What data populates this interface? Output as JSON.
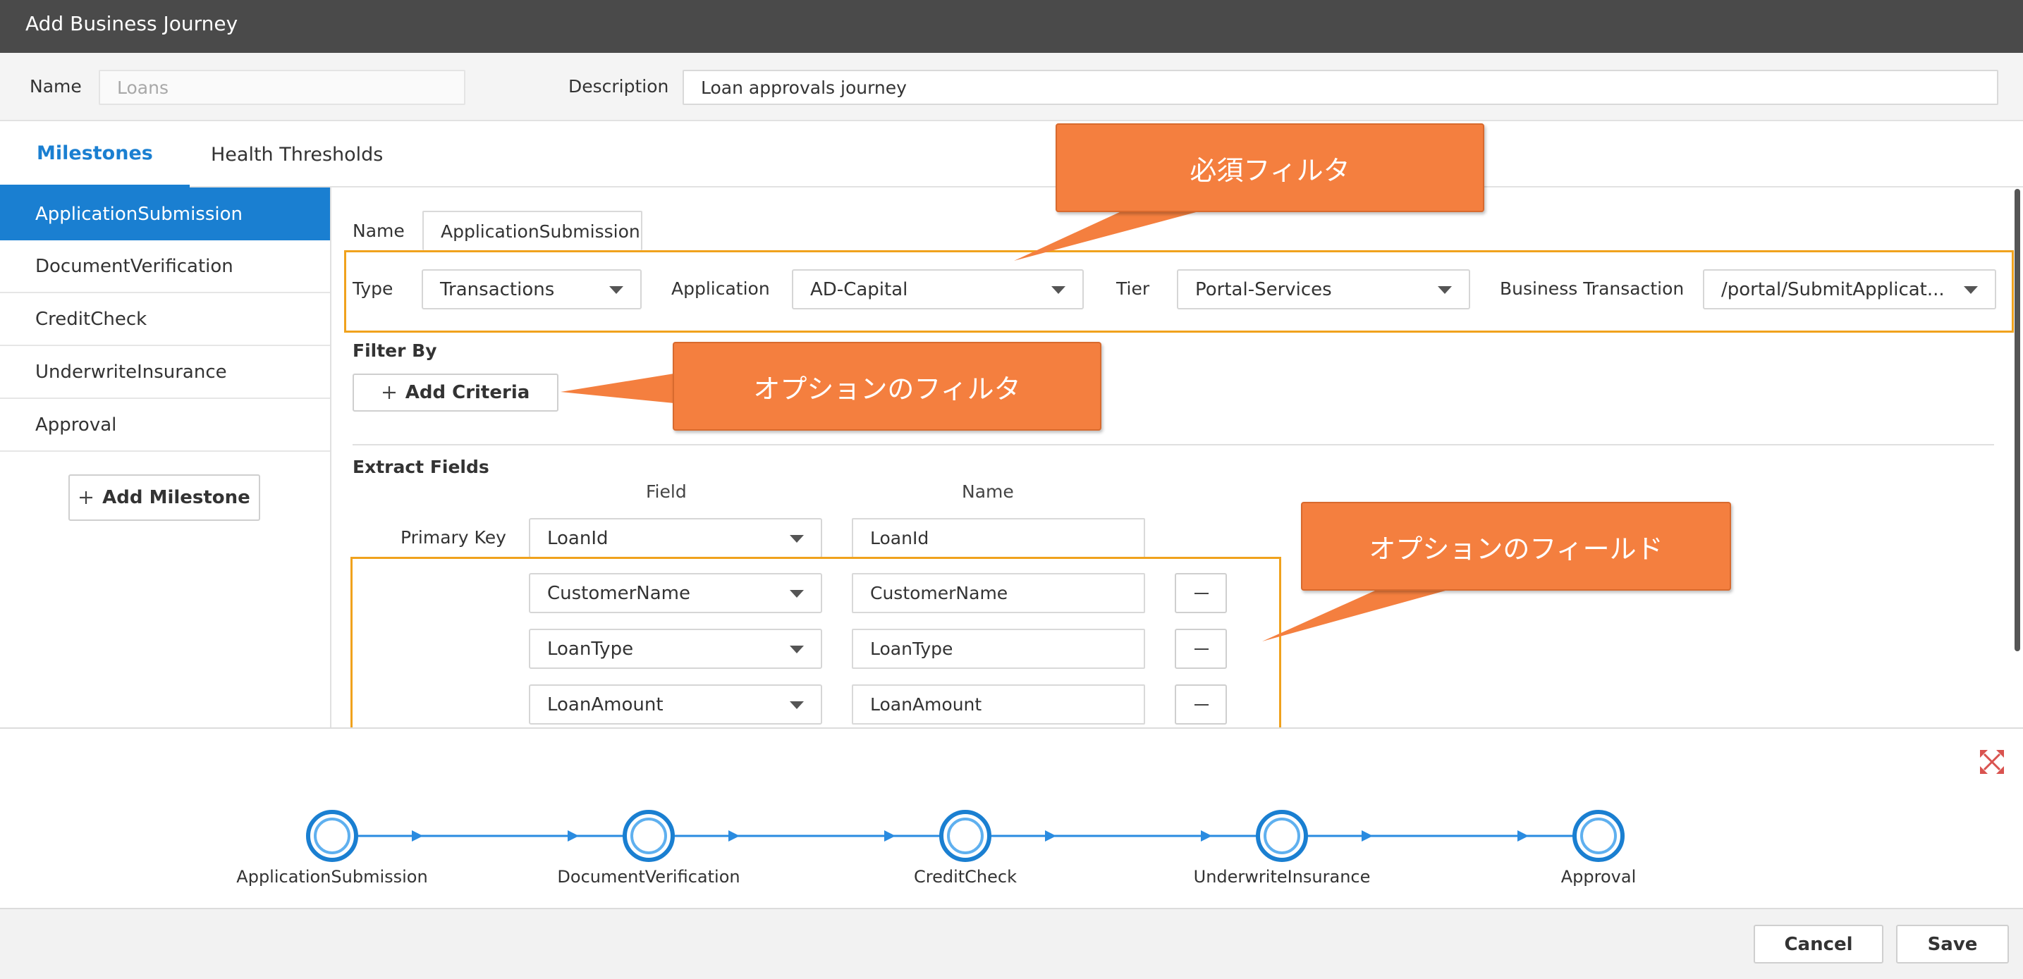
{
  "window": {
    "title": "Add Business Journey"
  },
  "header": {
    "name_label": "Name",
    "name_value": "Loans",
    "description_label": "Description",
    "description_value": "Loan approvals journey"
  },
  "tabs": [
    {
      "label": "Milestones",
      "active": true
    },
    {
      "label": "Health Thresholds",
      "active": false
    }
  ],
  "sidebar": {
    "items": [
      {
        "label": "ApplicationSubmission",
        "active": true
      },
      {
        "label": "DocumentVerification"
      },
      {
        "label": "CreditCheck"
      },
      {
        "label": "UnderwriteInsurance"
      },
      {
        "label": "Approval"
      }
    ],
    "add_label": "Add Milestone"
  },
  "milestone": {
    "name_label": "Name",
    "name_value": "ApplicationSubmission",
    "type_label": "Type",
    "type_value": "Transactions",
    "application_label": "Application",
    "application_value": "AD-Capital",
    "tier_label": "Tier",
    "tier_value": "Portal-Services",
    "bt_label": "Business Transaction",
    "bt_value": "/portal/SubmitApplicat..."
  },
  "filter": {
    "title": "Filter By",
    "add_label": "Add Criteria"
  },
  "extract": {
    "title": "Extract Fields",
    "field_header": "Field",
    "name_header": "Name",
    "primary_key_label": "Primary Key",
    "rows": [
      {
        "field": "LoanId",
        "name": "LoanId"
      },
      {
        "field": "CustomerName",
        "name": "CustomerName"
      },
      {
        "field": "LoanType",
        "name": "LoanType"
      },
      {
        "field": "LoanAmount",
        "name": "LoanAmount"
      }
    ]
  },
  "callouts": {
    "required_filter": "必須フィルタ",
    "optional_filter": "オプションのフィルタ",
    "optional_fields": "オプションのフィールド"
  },
  "flow": {
    "nodes": [
      "ApplicationSubmission",
      "DocumentVerification",
      "CreditCheck",
      "UnderwriteInsurance",
      "Approval"
    ]
  },
  "footer": {
    "cancel_label": "Cancel",
    "save_label": "Save"
  },
  "colors": {
    "accent": "#1a7fd1",
    "callout": "#f47f3f",
    "highlight": "#f0a21d"
  },
  "icons": {
    "add": "plus-icon",
    "dropdown": "caret-down-icon",
    "remove": "minus-icon",
    "expand": "expand-icon"
  }
}
